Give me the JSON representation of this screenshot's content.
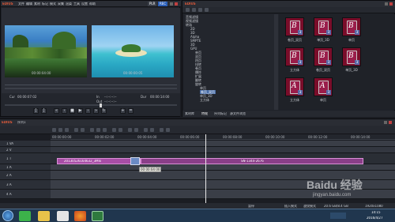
{
  "player": {
    "menu": [
      "EDIUS",
      "文件",
      "编辑",
      "素材",
      "标记",
      "模式",
      "采集",
      "渲染",
      "工具",
      "设置",
      "帮助"
    ],
    "mode": "PLR",
    "mode2": "REC",
    "left_monitor_tc": "00:00:04:00",
    "right_monitor_tc": "00:00:00:05",
    "cur": "Cur",
    "cur_tc": "00:00:07:02",
    "in": "In",
    "out": "Out",
    "dur": "Dur",
    "in_tc": "--:--:--:--",
    "out_tc": "--:--:--:--",
    "dur_tc": "00:00:14:00"
  },
  "bin": {
    "title": "EDIUS",
    "tree": [
      "音频滤镜",
      "视频滤镜",
      "转场",
      "2D",
      "3D",
      "Alpha",
      "SMPTE",
      "3D",
      "GPU",
      "单页",
      "双页",
      "四页",
      "扭转",
      "卷页",
      "爆炸",
      "扩展",
      "翻转",
      "旋转",
      "单页",
      "卷页_双页",
      "单页_3D",
      "立方体"
    ],
    "selected_tree_item": "卷页_双页",
    "thumbs": [
      "卷页_双页",
      "单页_3D",
      "单页",
      "立方体",
      "卷页_双页",
      "单页_3D",
      "立方体",
      "单页"
    ],
    "tabs": [
      "素材库",
      "特效",
      "序列标记",
      "源文件浏览"
    ]
  },
  "timeline": {
    "menu": [
      "EDIUS",
      "序列1"
    ],
    "ruler": [
      "00:00:00:00",
      "00:00:02:00",
      "00:00:04:00",
      "00:00:06:00",
      "00:00:08:00",
      "00:00:10:00",
      "00:00:12:00",
      "00:00:14:00"
    ],
    "tracks": [
      "1 VA",
      "2 V",
      "1 T",
      "1 A",
      "2 A",
      "3 A",
      "4 A"
    ],
    "clip1": "20130526164632_3Mlx",
    "clip2": "SN-1344-2676",
    "tooltip": "00:00:04:00",
    "status": [
      "暂停",
      "",
      "插入模式",
      "波纹模式",
      "20.6 GB/8.4 GB",
      "1920x1080"
    ]
  },
  "taskbar": {
    "time": "14:15",
    "date": "2016/4/27",
    "apps": [
      "start",
      "360",
      "folder",
      "firefox",
      "edius"
    ]
  },
  "watermark": "Baidu 经验",
  "watermark_url": "jingyan.baidu.com",
  "colors": {
    "clip": "#a84ea6",
    "selected": "#4a6ea8"
  }
}
